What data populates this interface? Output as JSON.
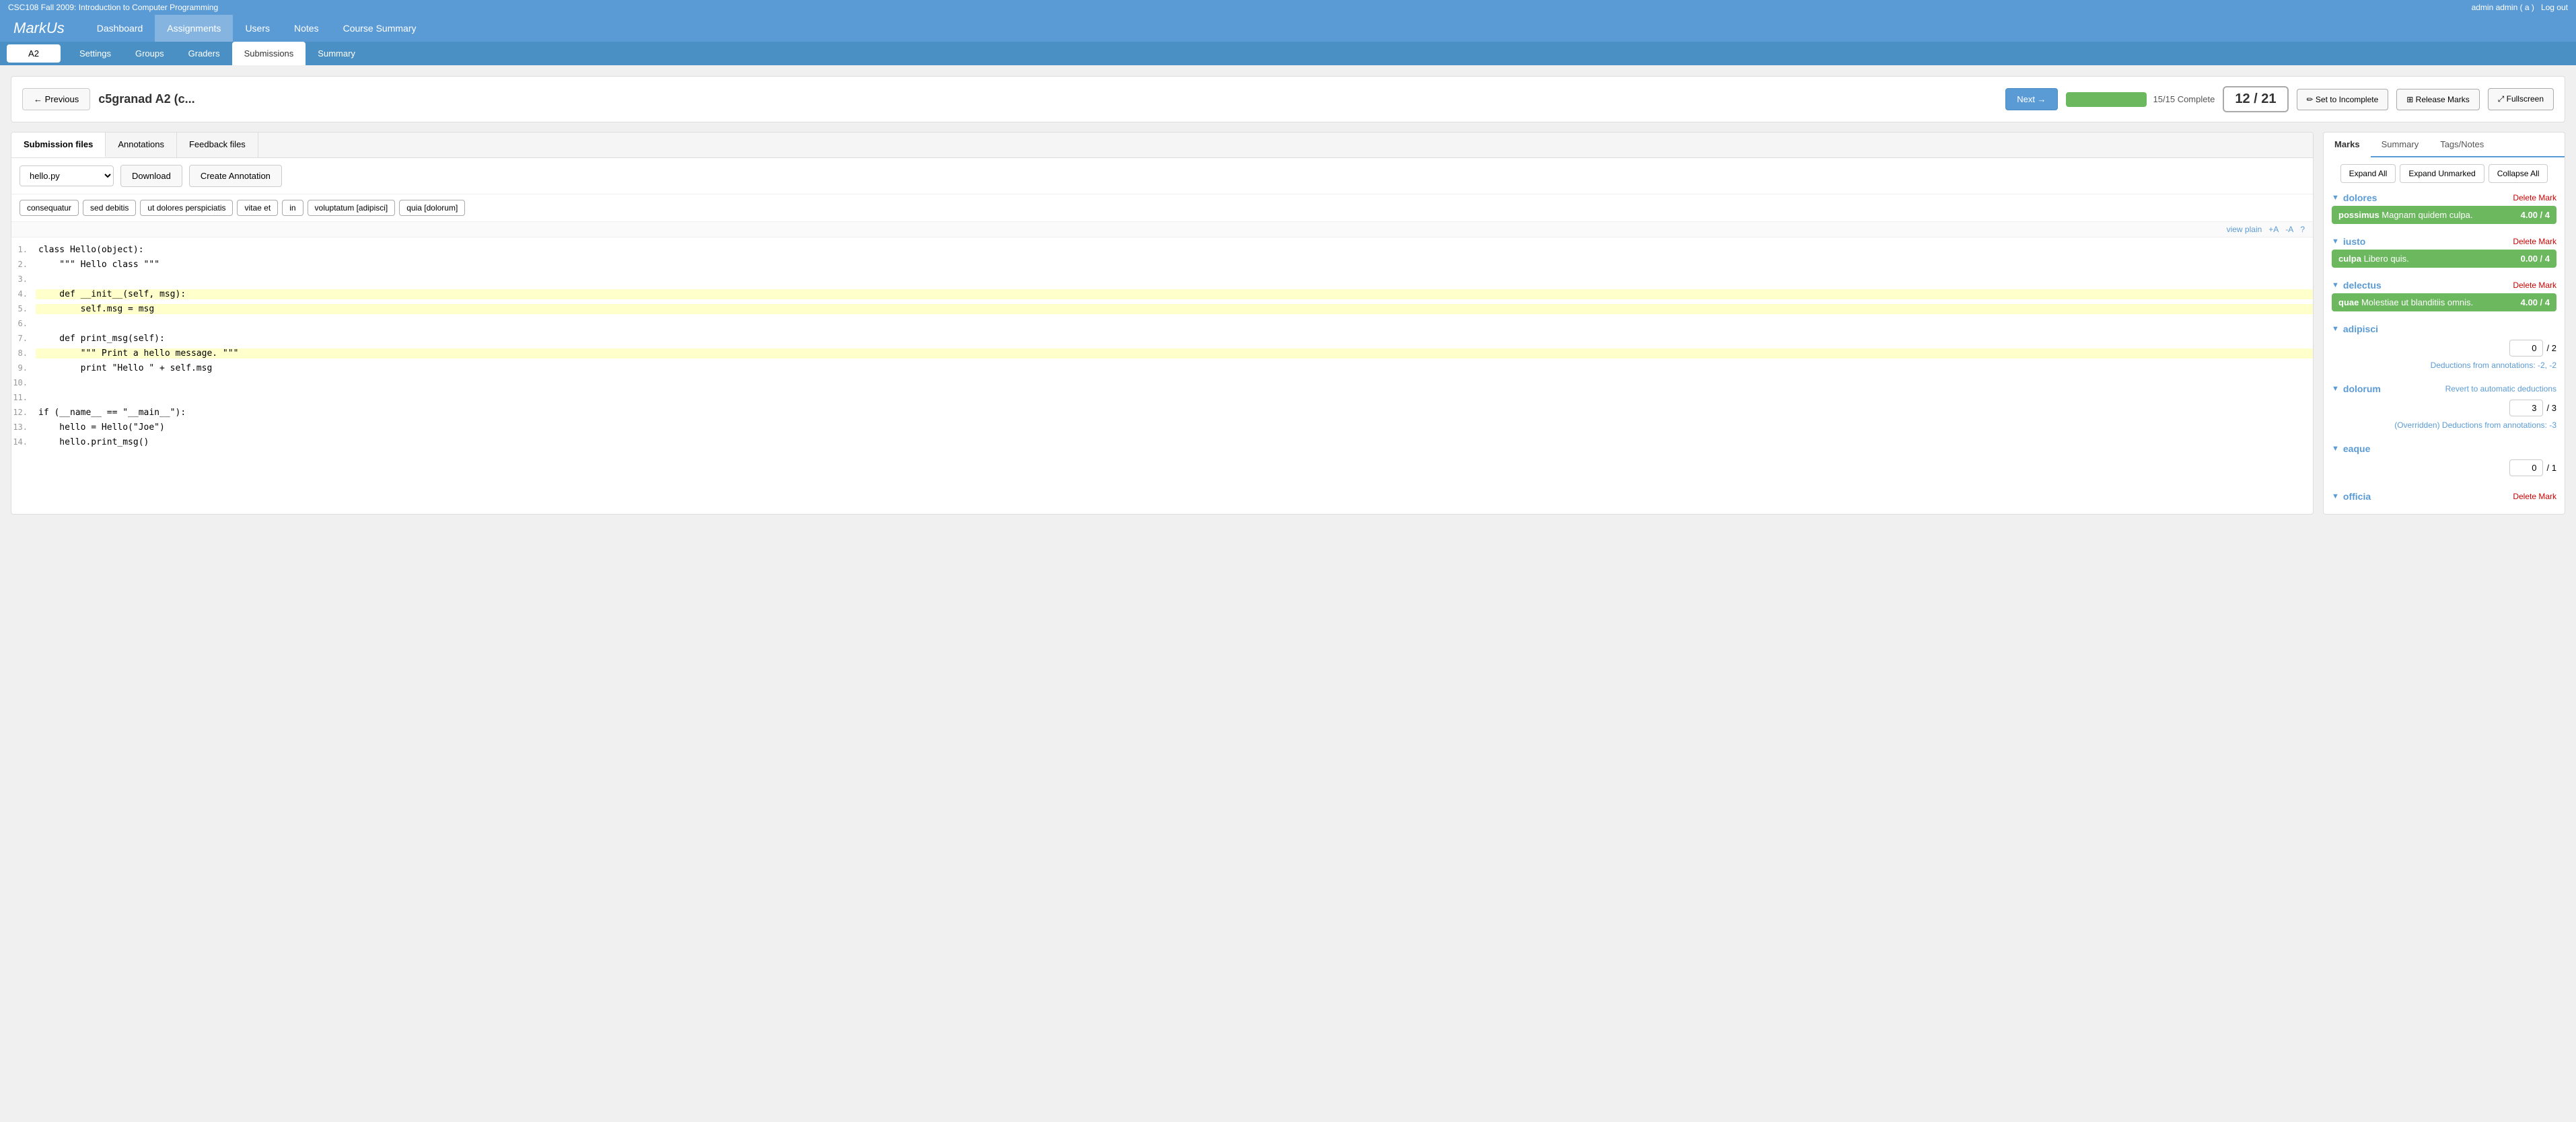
{
  "topBar": {
    "courseTitle": "CSC108 Fall 2009: Introduction to Computer Programming",
    "adminText": "admin admin ( a )",
    "logoutLabel": "Log out"
  },
  "nav": {
    "logoText": "MarkUs",
    "items": [
      {
        "id": "dashboard",
        "label": "Dashboard"
      },
      {
        "id": "assignments",
        "label": "Assignments"
      },
      {
        "id": "users",
        "label": "Users"
      },
      {
        "id": "notes",
        "label": "Notes"
      },
      {
        "id": "course-summary",
        "label": "Course Summary"
      }
    ]
  },
  "subNav": {
    "currentAssignment": "A2",
    "items": [
      {
        "id": "settings",
        "label": "Settings"
      },
      {
        "id": "groups",
        "label": "Groups"
      },
      {
        "id": "graders",
        "label": "Graders"
      },
      {
        "id": "submissions",
        "label": "Submissions",
        "active": true
      },
      {
        "id": "summary",
        "label": "Summary"
      }
    ]
  },
  "submissionHeader": {
    "prevLabel": "← Previous",
    "nextLabel": "Next →",
    "studentName": "c5granad A2 (c...",
    "progressFill": "100%",
    "progressText": "15/15 Complete",
    "pageCounter": "12 / 21",
    "setIncompleteLabel": "✏ Set to Incomplete",
    "releaseMarksLabel": "⊞ Release Marks",
    "fullscreenLabel": "⤢ Fullscreen"
  },
  "leftPanel": {
    "tabs": [
      {
        "id": "submission-files",
        "label": "Submission files",
        "active": true
      },
      {
        "id": "annotations",
        "label": "Annotations"
      },
      {
        "id": "feedback-files",
        "label": "Feedback files"
      }
    ],
    "fileSelect": {
      "value": "hello.py",
      "options": [
        "hello.py"
      ]
    },
    "downloadLabel": "Download",
    "createAnnotationLabel": "Create Annotation",
    "tags": [
      "consequatur",
      "sed debitis",
      "ut dolores perspiciatis",
      "vitae et",
      "in",
      "voluptatum [adipisci]",
      "quia [dolorum]"
    ],
    "codeControls": {
      "viewPlainLabel": "view plain",
      "plusALabel": "+A",
      "minusALabel": "-A",
      "questionLabel": "?"
    },
    "codeLines": [
      {
        "num": "1.",
        "content": "class Hello(object):",
        "highlight": ""
      },
      {
        "num": "2.",
        "content": "    \"\"\" Hello class \"\"\"",
        "highlight": ""
      },
      {
        "num": "3.",
        "content": "",
        "highlight": ""
      },
      {
        "num": "4.",
        "content": "    def __init__(self, msg):",
        "highlight": "yellow"
      },
      {
        "num": "5.",
        "content": "        self.msg = msg",
        "highlight": "yellow"
      },
      {
        "num": "6.",
        "content": "",
        "highlight": ""
      },
      {
        "num": "7.",
        "content": "    def print_msg(self):",
        "highlight": ""
      },
      {
        "num": "8.",
        "content": "        \"\"\" Print a hello message. \"\"\"",
        "highlight": "yellow"
      },
      {
        "num": "9.",
        "content": "        print \"Hello \" + self.msg",
        "highlight": ""
      },
      {
        "num": "10.",
        "content": "",
        "highlight": ""
      },
      {
        "num": "11.",
        "content": "",
        "highlight": ""
      },
      {
        "num": "12.",
        "content": "if (__name__ == \"__main__\"):",
        "highlight": ""
      },
      {
        "num": "13.",
        "content": "    hello = Hello(\"Joe\")",
        "highlight": ""
      },
      {
        "num": "14.",
        "content": "    hello.print_msg()",
        "highlight": ""
      }
    ]
  },
  "rightPanel": {
    "tabs": [
      {
        "id": "marks",
        "label": "Marks",
        "active": true
      },
      {
        "id": "summary",
        "label": "Summary"
      },
      {
        "id": "tags-notes",
        "label": "Tags/Notes"
      }
    ],
    "expandAllLabel": "Expand All",
    "expandUnmarkedLabel": "Expand Unmarked",
    "collapseAllLabel": "Collapse All",
    "sections": [
      {
        "id": "dolores",
        "title": "dolores",
        "hasDelete": true,
        "deleteLabel": "Delete Mark",
        "items": [
          {
            "label": "possimus",
            "desc": "Magnam quidem culpa.",
            "score": "4.00 / 4",
            "color": "green"
          }
        ]
      },
      {
        "id": "iusto",
        "title": "iusto",
        "hasDelete": true,
        "deleteLabel": "Delete Mark",
        "items": [
          {
            "label": "culpa",
            "desc": "Libero quis.",
            "score": "0.00 / 4",
            "color": "green"
          }
        ]
      },
      {
        "id": "delectus",
        "title": "delectus",
        "hasDelete": true,
        "deleteLabel": "Delete Mark",
        "items": [
          {
            "label": "quae",
            "desc": "Molestiae ut blanditiis omnis.",
            "score": "4.00 / 4",
            "color": "green"
          }
        ]
      },
      {
        "id": "adipisci",
        "title": "adipisci",
        "hasDelete": false,
        "inputValue": "0",
        "maxScore": "2",
        "deductionText": "Deductions from annotations: -2, -2"
      },
      {
        "id": "dolorum",
        "title": "dolorum",
        "hasDelete": false,
        "hasRevert": true,
        "revertLabel": "Revert to automatic deductions",
        "inputValue": "3",
        "maxScore": "3",
        "overriddenText": "(Overridden) Deductions from annotations: -3"
      },
      {
        "id": "eaque",
        "title": "eaque",
        "hasDelete": false,
        "inputValue": "0",
        "maxScore": "1"
      },
      {
        "id": "officia",
        "title": "officia",
        "hasDelete": true,
        "deleteLabel": "Delete Mark",
        "items": []
      }
    ]
  }
}
